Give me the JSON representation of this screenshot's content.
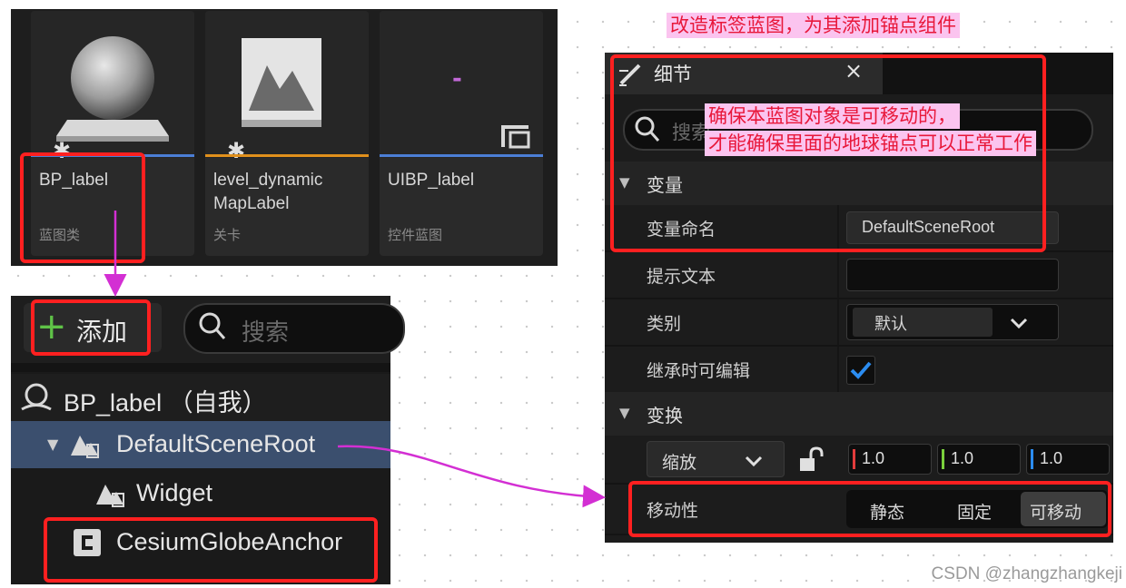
{
  "annotations": {
    "top_title": "改造标签蓝图，为其添加锚点组件",
    "note_line1": "确保本蓝图对象是可移动的，",
    "note_line2": "才能确保里面的地球锚点可以正常工作",
    "arrow_color": "#d32fd3",
    "box_color": "#ff2020"
  },
  "content_browser": {
    "assets": [
      {
        "name": "BP_label",
        "type": "蓝图类",
        "thumb": "sphere-icon",
        "bar_color": "#4b7ed6"
      },
      {
        "name": "level_dynamic MapLabel",
        "name_line1": "level_dynamic",
        "name_line2": "MapLabel",
        "type": "关卡",
        "thumb": "mountain-icon",
        "bar_color": "#e0901c"
      },
      {
        "name": "UIBP_label",
        "type": "控件蓝图",
        "thumb": "dash",
        "thumb_text": "-",
        "bar_color": "#4b7ed6"
      }
    ]
  },
  "components": {
    "add_label": "添加",
    "search_placeholder": "搜索",
    "self_item": "BP_label （自我）",
    "items": [
      "DefaultSceneRoot",
      "Widget",
      "CesiumGlobeAnchor"
    ]
  },
  "details": {
    "tab_title": "细节",
    "close": "×",
    "search_placeholder": "搜索",
    "sections": {
      "variables": "变量",
      "transform": "变换"
    },
    "rows": {
      "var_name_label": "变量命名",
      "var_name_value": "DefaultSceneRoot",
      "tooltip_label": "提示文本",
      "tooltip_value": "",
      "category_label": "类别",
      "category_value": "默认",
      "editable_label": "继承时可编辑",
      "editable_checked": true,
      "scale_label": "缩放",
      "scale_values": [
        "1.0",
        "1.0",
        "1.0"
      ],
      "mobility_label": "移动性",
      "mobility_options": [
        "静态",
        "固定",
        "可移动"
      ],
      "mobility_selected": "可移动"
    }
  },
  "watermark": "CSDN @zhangzhangkeji"
}
